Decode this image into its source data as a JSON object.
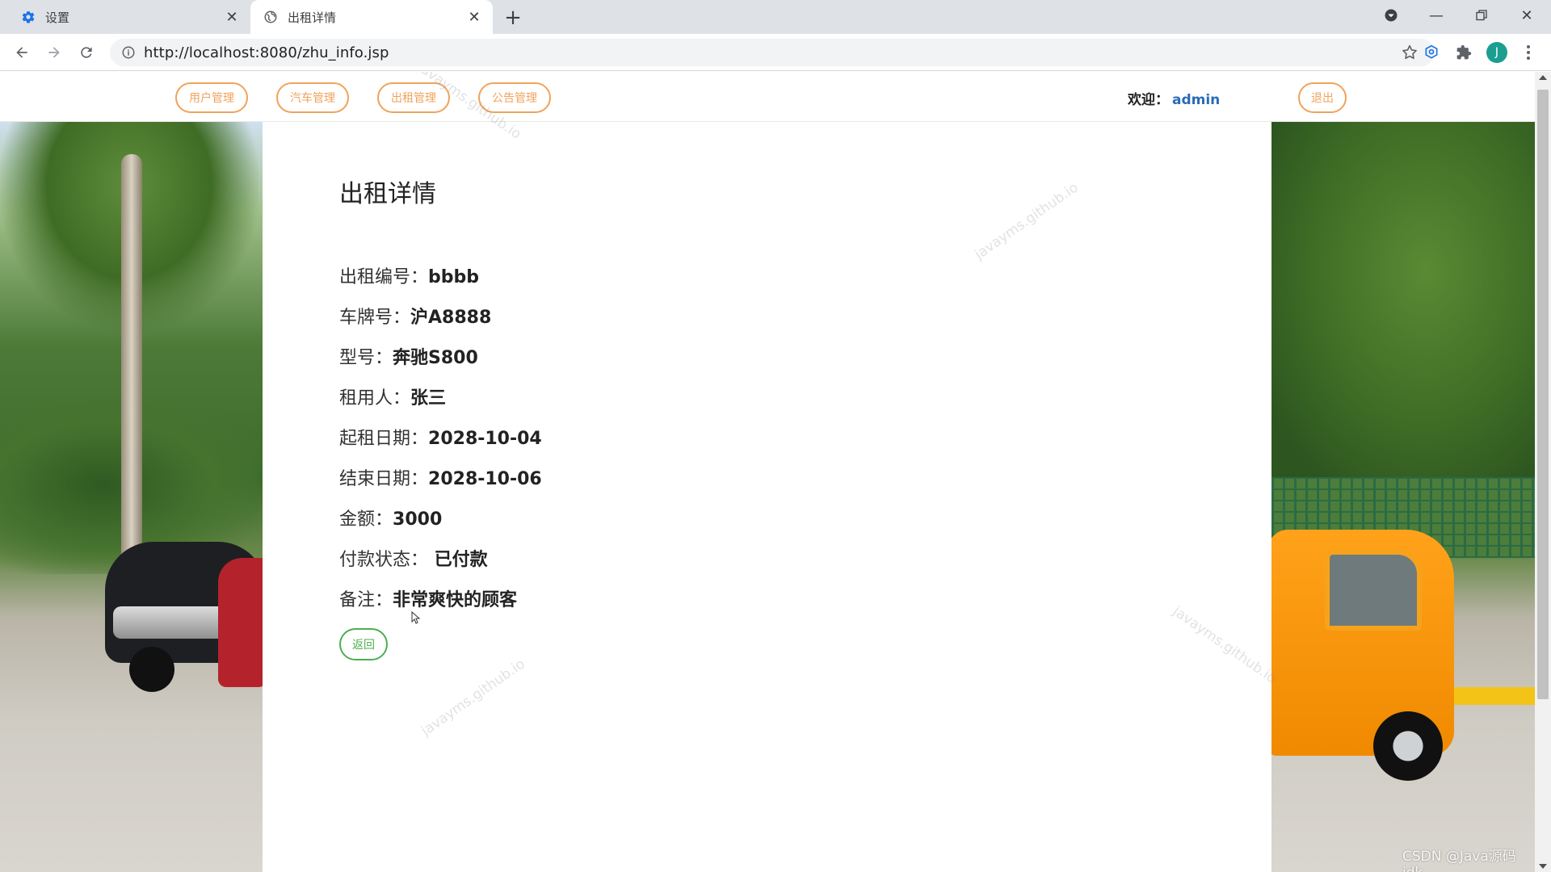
{
  "browser": {
    "tabs": [
      {
        "title": "设置",
        "icon": "gear-icon"
      },
      {
        "title": "出租详情",
        "icon": "globe-icon"
      }
    ],
    "url": "http://localhost:8080/zhu_info.jsp",
    "profile_initial": "J"
  },
  "nav": {
    "items": [
      "用户管理",
      "汽车管理",
      "出租管理",
      "公告管理"
    ],
    "welcome_label": "欢迎：",
    "username": "admin",
    "logout_label": "退出"
  },
  "detail": {
    "heading": "出租详情",
    "fields": [
      {
        "label": "出租编号：",
        "value": "bbbb"
      },
      {
        "label": "车牌号：",
        "value": "沪A8888"
      },
      {
        "label": "型号：",
        "value": "奔驰S800"
      },
      {
        "label": "租用人：",
        "value": "张三"
      },
      {
        "label": "起租日期：",
        "value": "2028-10-04"
      },
      {
        "label": "结束日期：",
        "value": "2028-10-06"
      },
      {
        "label": "金额：",
        "value": "3000"
      },
      {
        "label": "付款状态：",
        "value": " 已付款"
      },
      {
        "label": "备注：",
        "value": "非常爽快的顾客"
      }
    ],
    "back_label": "返回"
  },
  "watermark_text": "javayms.github.io",
  "corner_credit": "CSDN @Java源码jdk",
  "colors": {
    "nav_pill": "#f0a35c",
    "back_button": "#4caf50",
    "username": "#2a6cb8"
  }
}
